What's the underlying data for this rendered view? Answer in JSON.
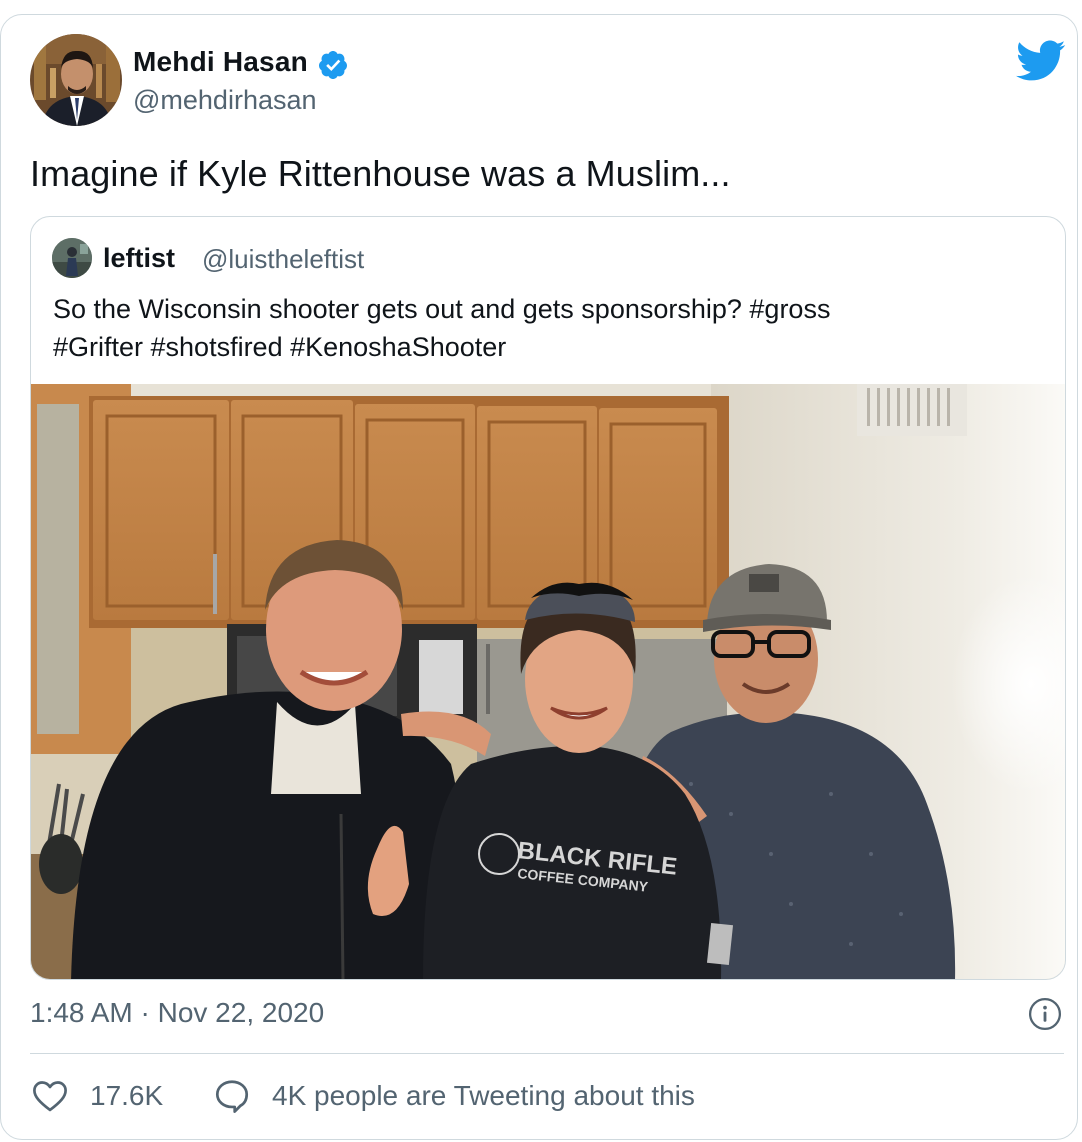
{
  "tweet": {
    "author": {
      "name": "Mehdi Hasan",
      "handle": "@mehdirhasan",
      "verified": true
    },
    "text": "Imagine if Kyle Rittenhouse was a Muslim...",
    "timestamp": "1:48 AM · Nov 22, 2020",
    "likes": "17.6K",
    "conversation_text": "4K people are Tweeting about this"
  },
  "quoted": {
    "name": "leftist",
    "handle": "@luistheleftist",
    "text_line1": "So the Wisconsin shooter gets out and gets sponsorship? #gross",
    "text_line2": "#Grifter #shotsfired #KenoshaShooter",
    "photo_shirt_line1": "BLACK RIFLE",
    "photo_shirt_line2": "COFFEE COMPANY"
  },
  "colors": {
    "twitter_blue": "#1d9bf0",
    "text_primary": "#0f1419",
    "text_secondary": "#536471",
    "border": "#cfd9de"
  },
  "icons": {
    "bird": "twitter-bird-icon",
    "verified": "verified-badge-icon",
    "info": "info-icon",
    "like": "heart-icon",
    "reply": "speech-bubble-icon"
  }
}
